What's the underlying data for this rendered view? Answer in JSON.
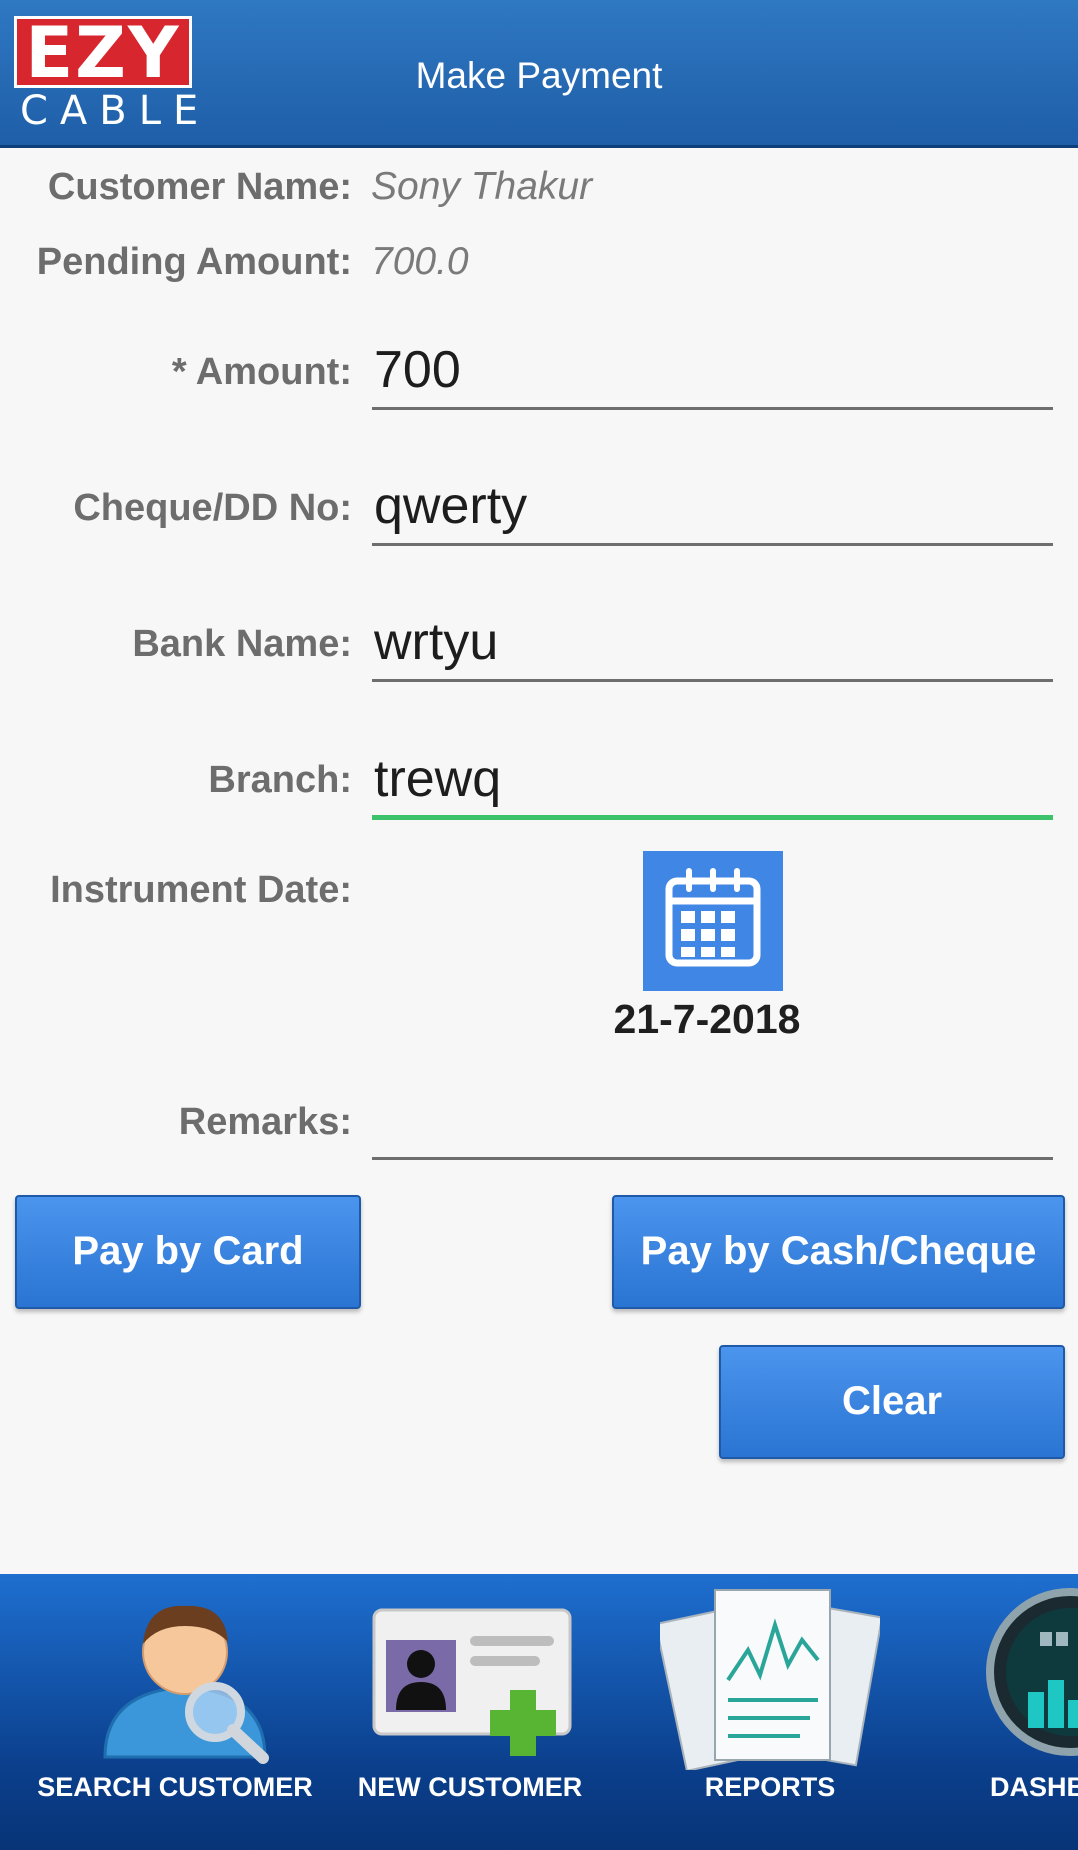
{
  "header": {
    "logo_top": "EZY",
    "logo_bottom": "CABLE",
    "title": "Make Payment"
  },
  "form": {
    "customer_name_label": "Customer Name:",
    "customer_name_value": "Sony Thakur",
    "pending_amount_label": "Pending Amount:",
    "pending_amount_value": "700.0",
    "amount_label": "* Amount:",
    "amount_value": "700",
    "cheque_label": "Cheque/DD No:",
    "cheque_value": "qwerty",
    "bank_label": "Bank Name:",
    "bank_value": "wrtyu",
    "branch_label": "Branch:",
    "branch_value": "trewq",
    "instrument_date_label": "Instrument Date:",
    "instrument_date_value": "21-7-2018",
    "remarks_label": "Remarks:",
    "remarks_value": ""
  },
  "buttons": {
    "pay_card": "Pay by Card",
    "pay_cash": "Pay by Cash/Cheque",
    "clear": "Clear"
  },
  "bottom_nav": {
    "items": [
      {
        "label": "SEARCH CUSTOMER",
        "icon": "search-customer-icon"
      },
      {
        "label": "NEW CUSTOMER",
        "icon": "new-customer-icon"
      },
      {
        "label": "REPORTS",
        "icon": "reports-icon"
      },
      {
        "label": "DASHB",
        "icon": "dashboard-icon"
      }
    ]
  },
  "colors": {
    "header": "#2a6fb9",
    "button": "#3a86e6",
    "active_underline": "#3cc26b",
    "calendar": "#4086e4",
    "logo_red": "#d8262e"
  }
}
